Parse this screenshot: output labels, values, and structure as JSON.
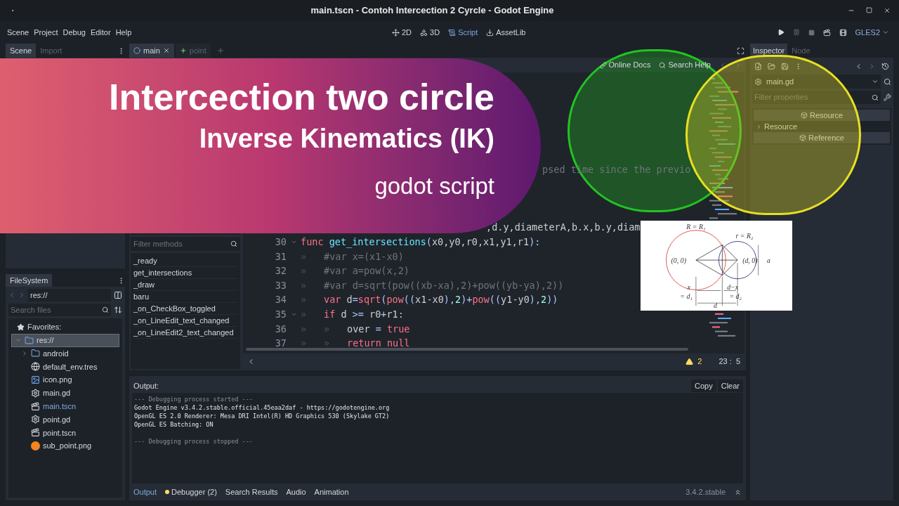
{
  "window": {
    "title": "main.tscn - Contoh Intercection 2 Cyrcle - Godot Engine"
  },
  "menu": [
    "Scene",
    "Project",
    "Debug",
    "Editor",
    "Help"
  ],
  "workspaces": [
    {
      "label": "2D",
      "kind": "flat",
      "selected": false
    },
    {
      "label": "3D",
      "kind": "spatial",
      "selected": false
    },
    {
      "label": "Script",
      "kind": "script",
      "selected": true
    },
    {
      "label": "AssetLib",
      "kind": "assetlib",
      "selected": false
    }
  ],
  "renderer": "GLES2",
  "scene_dock": {
    "tabs": [
      {
        "label": "Scene",
        "selected": true
      },
      {
        "label": "Import",
        "selected": false
      }
    ]
  },
  "editor_tabs": [
    {
      "label": "main",
      "kind": "scene",
      "selected": true
    },
    {
      "label": "point",
      "kind": "node",
      "selected": false
    }
  ],
  "script_toolbar": [
    {
      "label": "Online Docs",
      "kind": "docs"
    },
    {
      "label": "Search Help",
      "kind": "help"
    }
  ],
  "methods": {
    "placeholder": "Filter methods",
    "items": [
      "_ready",
      "get_intersections",
      "_draw",
      "baru",
      "_on_CheckBox_toggled",
      "_on_LineEdit_text_changed",
      "_on_LineEdit2_text_changed"
    ]
  },
  "code": {
    "fragments": [
      {
        "tokens": [
          {
            "kind": "comment",
            "text": "psed time since the previo"
          }
        ]
      },
      {
        "tokens": [
          {
            "kind": "plain",
            "text": ",d.y,diameterA,b.x,b.y,diam"
          }
        ]
      }
    ],
    "lines": [
      {
        "number": "30",
        "fold": true,
        "tokens": [
          {
            "kind": "keyword",
            "text": "func "
          },
          {
            "kind": "function",
            "text": "get_intersections"
          },
          {
            "kind": "symbol",
            "text": "("
          },
          {
            "kind": "plain",
            "text": "x0,y0,r0,x1,y1,r1"
          },
          {
            "kind": "symbol",
            "text": "):"
          }
        ]
      },
      {
        "number": "31",
        "fold": false,
        "tokens": [
          {
            "kind": "tab",
            "text": "»"
          },
          {
            "kind": "comment",
            "text": "#var x=(x1-x0)"
          }
        ]
      },
      {
        "number": "32",
        "fold": false,
        "tokens": [
          {
            "kind": "tab",
            "text": "»"
          },
          {
            "kind": "comment",
            "text": "#var a=pow(x,2)"
          }
        ]
      },
      {
        "number": "33",
        "fold": false,
        "tokens": [
          {
            "kind": "tab",
            "text": "»"
          },
          {
            "kind": "comment",
            "text": "#var d=sqrt(pow((xb-xa),2)+pow((yb-ya),2))"
          }
        ]
      },
      {
        "number": "34",
        "fold": false,
        "tokens": [
          {
            "kind": "tab",
            "text": "»"
          },
          {
            "kind": "keyword",
            "text": "var"
          },
          {
            "kind": "plain",
            "text": " d"
          },
          {
            "kind": "symbol",
            "text": "="
          },
          {
            "kind": "keyword",
            "text": "sqrt"
          },
          {
            "kind": "symbol",
            "text": "("
          },
          {
            "kind": "keyword",
            "text": "pow"
          },
          {
            "kind": "symbol",
            "text": "(("
          },
          {
            "kind": "plain",
            "text": "x1"
          },
          {
            "kind": "symbol",
            "text": "-"
          },
          {
            "kind": "plain",
            "text": "x0"
          },
          {
            "kind": "symbol",
            "text": "),"
          },
          {
            "kind": "number",
            "text": "2"
          },
          {
            "kind": "symbol",
            "text": ")+"
          },
          {
            "kind": "keyword",
            "text": "pow"
          },
          {
            "kind": "symbol",
            "text": "(("
          },
          {
            "kind": "plain",
            "text": "y1"
          },
          {
            "kind": "symbol",
            "text": "-"
          },
          {
            "kind": "plain",
            "text": "y0"
          },
          {
            "kind": "symbol",
            "text": "),"
          },
          {
            "kind": "number",
            "text": "2"
          },
          {
            "kind": "symbol",
            "text": "))"
          }
        ]
      },
      {
        "number": "35",
        "fold": true,
        "tokens": [
          {
            "kind": "tab",
            "text": "»"
          },
          {
            "kind": "keyword",
            "text": "if"
          },
          {
            "kind": "plain",
            "text": " d "
          },
          {
            "kind": "symbol",
            "text": ">="
          },
          {
            "kind": "plain",
            "text": " r0"
          },
          {
            "kind": "symbol",
            "text": "+"
          },
          {
            "kind": "plain",
            "text": "r1"
          },
          {
            "kind": "symbol",
            "text": ":"
          }
        ]
      },
      {
        "number": "36",
        "fold": false,
        "tokens": [
          {
            "kind": "tab",
            "text": "»"
          },
          {
            "kind": "tab",
            "text": "»"
          },
          {
            "kind": "plain",
            "text": "over "
          },
          {
            "kind": "symbol",
            "text": "="
          },
          {
            "kind": "keyword",
            "text": " true"
          }
        ]
      },
      {
        "number": "37",
        "fold": false,
        "tokens": [
          {
            "kind": "tab",
            "text": "»"
          },
          {
            "kind": "tab",
            "text": "»"
          },
          {
            "kind": "keyword",
            "text": "return null"
          }
        ]
      }
    ]
  },
  "status": {
    "warnings": "2",
    "position": "23 :  5"
  },
  "filesystem": {
    "title": "FileSystem",
    "path": "res://",
    "placeholder": "Search files",
    "favorites": "Favorites:",
    "tree": [
      {
        "name": "res://",
        "kind": "folder",
        "selected": true,
        "current": false,
        "expanded": true,
        "children": [
          {
            "name": "android",
            "kind": "folder",
            "selected": false,
            "current": false,
            "expanded": false
          },
          {
            "name": "default_env.tres",
            "kind": "environment",
            "selected": false,
            "current": false
          },
          {
            "name": "icon.png",
            "kind": "image",
            "selected": false,
            "current": false
          },
          {
            "name": "main.gd",
            "kind": "script",
            "selected": false,
            "current": false
          },
          {
            "name": "main.tscn",
            "kind": "scene",
            "selected": false,
            "current": true
          },
          {
            "name": "point.gd",
            "kind": "script",
            "selected": false,
            "current": false
          },
          {
            "name": "point.tscn",
            "kind": "scene",
            "selected": false,
            "current": false
          },
          {
            "name": "sub_point.png",
            "kind": "thumbnail",
            "selected": false,
            "current": false
          }
        ]
      }
    ]
  },
  "inspector": {
    "tabs": [
      {
        "label": "Inspector",
        "selected": true
      },
      {
        "label": "Node",
        "selected": false
      }
    ],
    "object": "main.gd",
    "placeholder": "Filter properties",
    "rows": [
      {
        "label": "Resource",
        "kind": "category"
      },
      {
        "label": "Resource",
        "kind": "section",
        "expanded": false
      },
      {
        "label": "Reference",
        "kind": "category"
      }
    ]
  },
  "output": {
    "title": "Output:",
    "buttons": [
      "Copy",
      "Clear"
    ],
    "lines": [
      {
        "text": "--- Debugging process started ---",
        "kind": "system"
      },
      {
        "text": "Godot Engine v3.4.2.stable.official.45eaa2daf - https://godotengine.org",
        "kind": "log"
      },
      {
        "text": "OpenGL ES 2.0 Renderer: Mesa DRI Intel(R) HD Graphics 530 (Skylake GT2)",
        "kind": "log"
      },
      {
        "text": "OpenGL ES Batching: ON",
        "kind": "log"
      },
      {
        "text": "--- Debugging process stopped ---",
        "kind": "system"
      }
    ],
    "tabs": [
      {
        "label": "Output",
        "selected": true,
        "badge": false
      },
      {
        "label": "Debugger (2)",
        "selected": false,
        "badge": true
      },
      {
        "label": "Search Results",
        "selected": false,
        "badge": false
      },
      {
        "label": "Audio",
        "selected": false,
        "badge": false
      },
      {
        "label": "Animation",
        "selected": false,
        "badge": false
      }
    ],
    "version": "3.4.2.stable"
  },
  "overlay": {
    "title": "Intercection two circle",
    "subtitle": "Inverse Kinematics (IK)",
    "caption": "godot script",
    "figure_labels": [
      "R = R₁",
      "r = R₂",
      "(0, 0)",
      "(d, 0)",
      "a",
      "x",
      "= d₁",
      "d−x",
      "= d₂",
      "d"
    ]
  }
}
